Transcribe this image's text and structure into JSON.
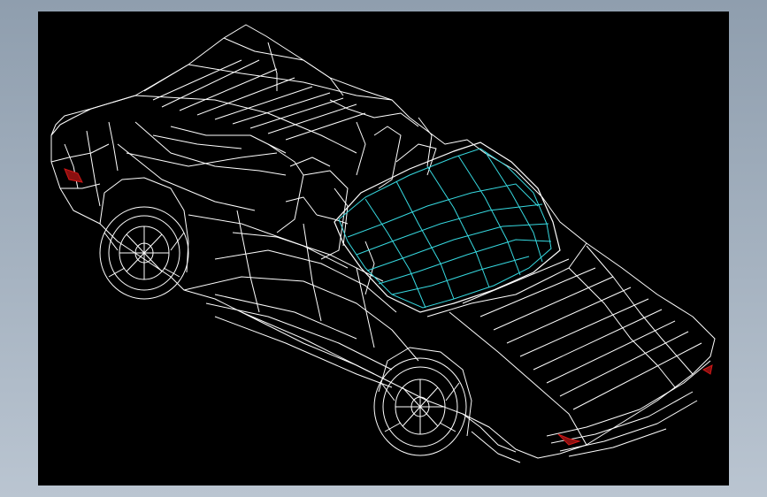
{
  "viewport": {
    "background": "#000000",
    "frame_color": "#9aa8b7",
    "subject": "car-wireframe-icon",
    "line_colors": {
      "body": "#ffffff",
      "windshield": "#36d9e0",
      "lights": "#d01818"
    }
  }
}
